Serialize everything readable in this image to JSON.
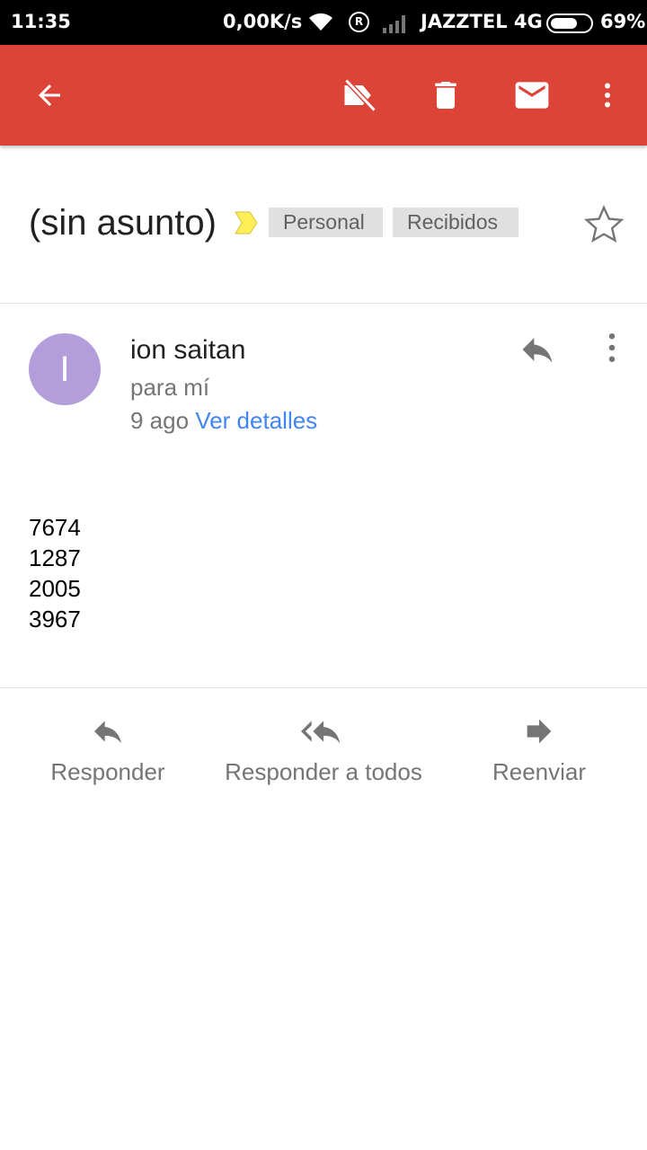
{
  "status_bar": {
    "time": "11:35",
    "speed": "0,00K/s",
    "roaming": "R",
    "carrier": "JAZZTEL 4G",
    "battery_percent": "69%",
    "battery_level": 0.69
  },
  "toolbar": {
    "icons": [
      "arrow-back-icon",
      "label-off-icon",
      "delete-icon",
      "mail-icon",
      "more-vert-icon"
    ]
  },
  "subject": {
    "title": "(sin asunto)",
    "labels": [
      "Personal",
      "Recibidos"
    ],
    "importance_color": "#ffee58",
    "starred": false
  },
  "message": {
    "avatar_letter": "I",
    "avatar_color": "#b39ddb",
    "sender": "ion saitan",
    "recipient": "para mí",
    "date": "9 ago",
    "details_link": "Ver detalles",
    "body_lines": [
      "7674",
      "1287",
      "2005",
      "3967"
    ]
  },
  "actions": {
    "reply": "Responder",
    "reply_all": "Responder a todos",
    "forward": "Reenviar"
  },
  "colors": {
    "app_bar": "#db4437",
    "link": "#4285f4"
  }
}
